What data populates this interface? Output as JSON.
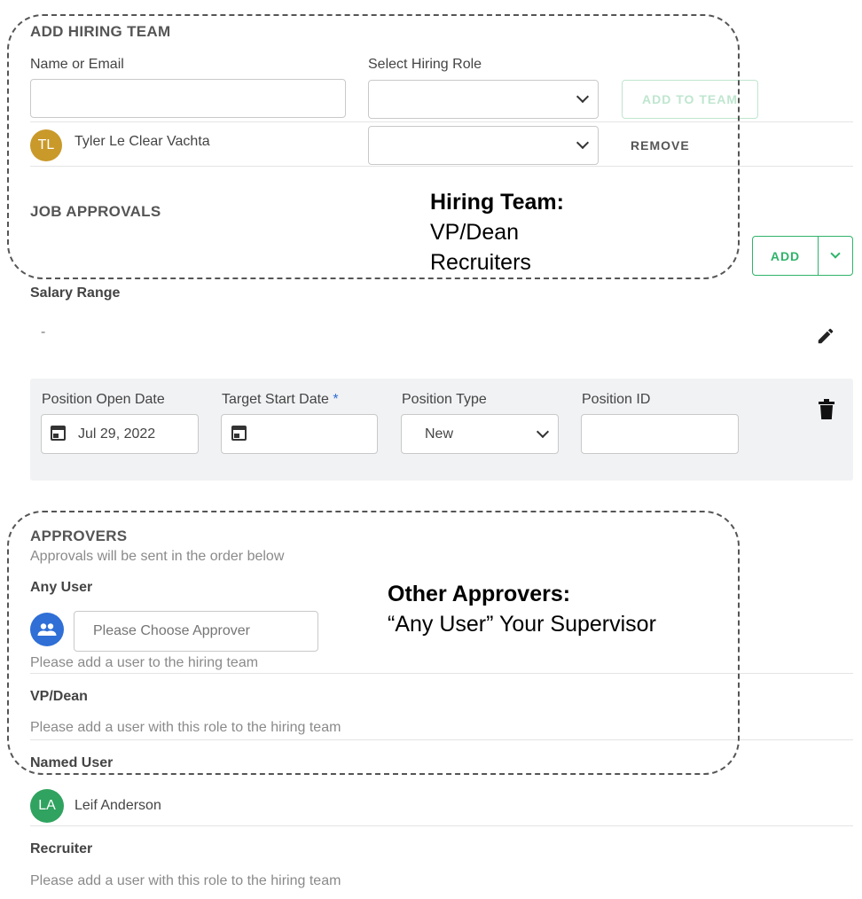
{
  "hiring_team": {
    "title": "ADD HIRING TEAM",
    "name_label": "Name or Email",
    "name_value": "",
    "role_label": "Select Hiring Role",
    "role_value": "",
    "add_to_team_label": "ADD TO TEAM",
    "members": [
      {
        "initials": "TL",
        "name": "Tyler Le Clear Vachta",
        "role": "",
        "remove_label": "REMOVE",
        "avatar_color": "#c9992a"
      }
    ]
  },
  "job_approvals": {
    "title": "JOB APPROVALS",
    "add_label": "ADD",
    "accent_color": "#2fb36a"
  },
  "salary": {
    "label": "Salary Range",
    "value": "-",
    "edit_icon": "pencil-icon"
  },
  "position": {
    "open_date_label": "Position Open Date",
    "open_date_value": "Jul 29, 2022",
    "target_start_label": "Target Start Date",
    "required_mark": "*",
    "target_start_value": "",
    "type_label": "Position Type",
    "type_value": "New",
    "id_label": "Position ID",
    "id_value": "",
    "delete_icon": "trash-icon"
  },
  "approvers": {
    "title": "APPROVERS",
    "subtitle": "Approvals will be sent in the order below",
    "groups": [
      {
        "label": "Any User",
        "placeholder": "Please Choose Approver",
        "note": "Please add a user to the hiring team",
        "icon": "people-icon",
        "icon_color": "#2f6fd6"
      },
      {
        "label": "VP/Dean",
        "note": "Please add a user with this role to the hiring team"
      },
      {
        "label": "Named User",
        "initials": "LA",
        "name": "Leif Anderson",
        "avatar_color": "#2fa35f"
      },
      {
        "label": "Recruiter",
        "note": "Please add a user with this role to the hiring team"
      }
    ]
  },
  "annotations": {
    "hiring_team": {
      "heading": "Hiring Team:",
      "lines": [
        "VP/Dean",
        "Recruiters"
      ]
    },
    "other_approvers": {
      "heading": "Other Approvers:",
      "line": "“Any User” Your Supervisor"
    }
  }
}
